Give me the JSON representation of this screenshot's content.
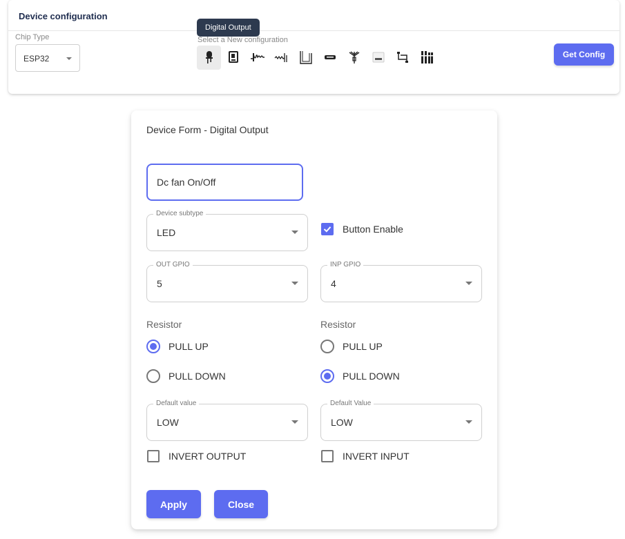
{
  "header": {
    "title": "Device configuration",
    "chip_type_label": "Chip Type",
    "chip_type_value": "ESP32",
    "tooltip": "Digital Output",
    "select_new_label": "Select a New configuration",
    "get_config_label": "Get Config",
    "icons": [
      "led-icon",
      "relay-icon",
      "servo-icon",
      "sensor-wave-icon",
      "tank-icon",
      "display-icon",
      "antenna-icon",
      "bus-module-icon",
      "i2c-icon",
      "multi-sensor-icon"
    ],
    "accent_color": "#5d6cf0"
  },
  "form": {
    "title": "Device Form - Digital Output",
    "name_value": "Dc fan On/Off",
    "device_subtype": {
      "label": "Device subtype",
      "value": "LED"
    },
    "button_enable": {
      "label": "Button Enable",
      "checked": true
    },
    "out_gpio": {
      "label": "OUT GPIO",
      "value": "5"
    },
    "inp_gpio": {
      "label": "INP GPIO",
      "value": "4"
    },
    "left_resistor": {
      "label": "Resistor",
      "pull_up": "PULL UP",
      "pull_down": "PULL DOWN",
      "selected": "PULL UP"
    },
    "right_resistor": {
      "label": "Resistor",
      "pull_up": "PULL UP",
      "pull_down": "PULL DOWN",
      "selected": "PULL DOWN"
    },
    "default_value_out": {
      "label": "Default value",
      "value": "LOW"
    },
    "default_value_in": {
      "label": "Default Value",
      "value": "LOW"
    },
    "invert_output": {
      "label": "INVERT OUTPUT",
      "checked": false
    },
    "invert_input": {
      "label": "INVERT INPUT",
      "checked": false
    },
    "apply_label": "Apply",
    "close_label": "Close"
  }
}
